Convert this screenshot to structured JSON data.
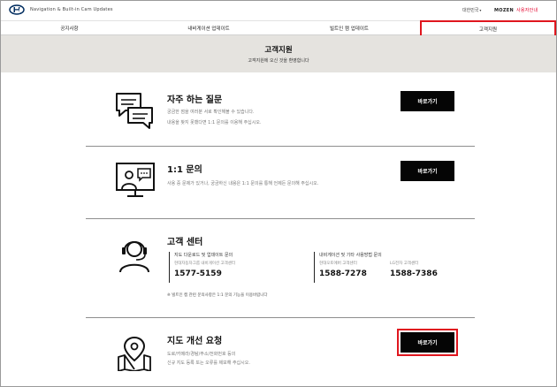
{
  "header": {
    "brand_text": "Navigation & Built-in Cam Updates",
    "lang_label": "대한민국",
    "mozen_brand": "MOZEN",
    "mozen_sub": "사용자안내"
  },
  "nav": {
    "items": [
      {
        "label": "공지사항"
      },
      {
        "label": "내비게이션 업데이트"
      },
      {
        "label": "빌트인 캠 업데이트"
      },
      {
        "label": "고객지원"
      }
    ]
  },
  "hero": {
    "title": "고객지원",
    "subtitle": "고객지원에 오신 것을 환영합니다"
  },
  "sections": {
    "faq": {
      "title": "자주 하는 질문",
      "desc1": "궁금한 점을 여러분 서로 확인해볼 수 있습니다.",
      "desc2": "내용을 찾지 못했다면 1:1 문의를 이용해 주십시오.",
      "button": "바로가기"
    },
    "inquiry": {
      "title": "1:1 문의",
      "desc1": "사용 중 문제가 있거나, 궁금하신 내용은 1:1 문의를 통해 언제든 문의해 주십시오.",
      "button": "바로가기"
    },
    "center": {
      "title": "고객 센터",
      "col1_head": "지도 다운로드 및 업데이트 문의",
      "col1_label": "현대자동차그룹 내비게이션 고객센터",
      "col1_num": "1577-5159",
      "col2_head": "내비게이션 및 기타 사용방법 문의",
      "col2_label_a": "현대오토에버 고객센터",
      "col2_num_a": "1588-7278",
      "col2_label_b": "LG전자 고객센터",
      "col2_num_b": "1588-7386",
      "notice": "※ 빌트인 캠 관련 문의사항은 1:1 문의 기능을 이용바랍니다"
    },
    "map_request": {
      "title": "지도 개선 요청",
      "desc1": "도로/카메라/경탐/주소/전화번호 등의",
      "desc2": "신규 지도 등록 또는 오류를 제보해 주십시오.",
      "button": "바로가기"
    }
  },
  "colors": {
    "highlight": "#e0161e",
    "button_bg": "#050505",
    "hero_bg": "#e5e3df"
  }
}
